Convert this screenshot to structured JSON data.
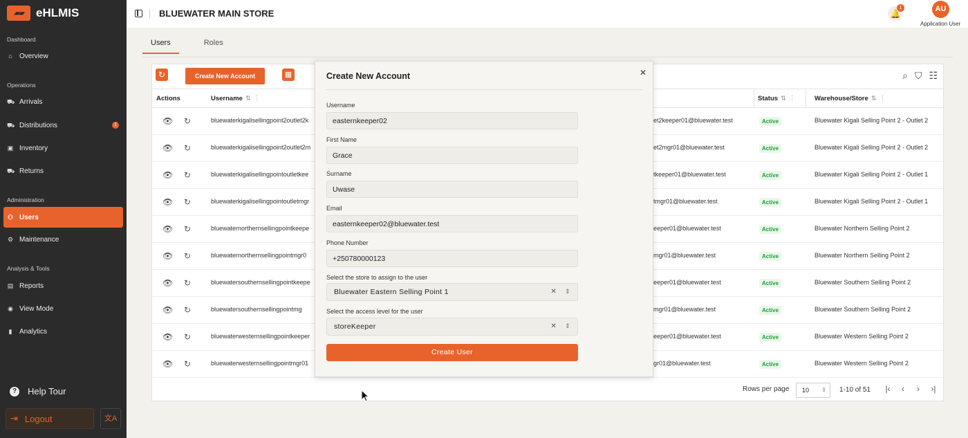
{
  "app": {
    "name": "eHLMIS"
  },
  "sidebar": {
    "sections": [
      {
        "label": "Dashboard"
      },
      {
        "label": "Operations"
      },
      {
        "label": "Administration"
      },
      {
        "label": "Analysis & Tools"
      }
    ],
    "items": [
      {
        "label": "Overview",
        "icon": "home-icon"
      },
      {
        "label": "Arrivals",
        "icon": "truck-icon"
      },
      {
        "label": "Distributions",
        "icon": "truck-icon",
        "badge": "1"
      },
      {
        "label": "Inventory",
        "icon": "box-icon"
      },
      {
        "label": "Returns",
        "icon": "truck-icon"
      },
      {
        "label": "Users",
        "icon": "users-icon",
        "active": true
      },
      {
        "label": "Maintenance",
        "icon": "gear-icon"
      },
      {
        "label": "Reports",
        "icon": "file-icon"
      },
      {
        "label": "View Mode",
        "icon": "eye-icon"
      },
      {
        "label": "Analytics",
        "icon": "bar-chart-icon"
      }
    ],
    "help": "Help Tour",
    "logout": "Logout",
    "lang_icon": "文A"
  },
  "header": {
    "store": "BLUEWATER MAIN STORE",
    "notification_count": "1",
    "avatar_initials": "AU",
    "user_role": "Application User"
  },
  "tabs": [
    {
      "label": "Users"
    },
    {
      "label": "Roles"
    }
  ],
  "toolbar": {
    "create_label": "Create New Account"
  },
  "table": {
    "headers": {
      "actions": "Actions",
      "username": "Username",
      "status": "Status",
      "warehouse": "Warehouse/Store"
    },
    "rows": [
      {
        "username": "bluewaterkigalisellingpoint2outlet2k",
        "email": "et2keeper01@bluewater.test",
        "status": "Active",
        "warehouse": "Bluewater Kigali Selling Point 2 - Outlet 2"
      },
      {
        "username": "bluewaterkigalisellingpoint2outlet2m",
        "email": "et2mgr01@bluewater.test",
        "status": "Active",
        "warehouse": "Bluewater Kigali Selling Point 2 - Outlet 2"
      },
      {
        "username": "bluewaterkigalisellingpointoutletkee",
        "email": "tkeeper01@bluewater.test",
        "status": "Active",
        "warehouse": "Bluewater Kigali Selling Point 2 - Outlet 1"
      },
      {
        "username": "bluewaterkigalisellingpointoutletmgr",
        "email": "tmgr01@bluewater.test",
        "status": "Active",
        "warehouse": "Bluewater Kigali Selling Point 2 - Outlet 1"
      },
      {
        "username": "bluewaternorthernsellingpointkeepe",
        "email": "eeper01@bluewater.test",
        "status": "Active",
        "warehouse": "Bluewater Northern Selling Point 2"
      },
      {
        "username": "bluewaternorthernsellingpointmgr0",
        "email": "mgr01@bluewater.test",
        "status": "Active",
        "warehouse": "Bluewater Northern Selling Point 2"
      },
      {
        "username": "bluewatersouthernsellingpointkeepe",
        "email": "eeper01@bluewater.test",
        "status": "Active",
        "warehouse": "Bluewater Southern Selling Point 2"
      },
      {
        "username": "bluewatersouthernsellingpointmg",
        "email": "mgr01@bluewater.test",
        "status": "Active",
        "warehouse": "Bluewater Southern Selling Point 2"
      },
      {
        "username": "bluewaterwesternsellingpointkeeper",
        "email": "eeper01@bluewater.test",
        "status": "Active",
        "warehouse": "Bluewater Western Selling Point 2"
      },
      {
        "username": "bluewaterwesternsellingpointmgr01",
        "email": "gr01@bluewater.test",
        "status": "Active",
        "warehouse": "Bluewater Western Selling Point 2"
      }
    ]
  },
  "pagination": {
    "rows_per_page_label": "Rows per page",
    "rows_per_page": "10",
    "range": "1-10 of 51"
  },
  "modal": {
    "title": "Create New Account",
    "fields": {
      "username": {
        "label": "Username",
        "value": "easternkeeper02"
      },
      "first_name": {
        "label": "First Name",
        "value": "Grace"
      },
      "surname": {
        "label": "Surname",
        "value": "Uwase"
      },
      "email": {
        "label": "Email",
        "value": "easternkeeper02@bluewater.test"
      },
      "phone": {
        "label": "Phone Number",
        "value": "+250780000123"
      },
      "store": {
        "label": "Select the store to assign to the user",
        "value": "Bluewater Eastern Selling Point 1"
      },
      "access": {
        "label": "Select the access level for the user",
        "value": "storeKeeper"
      }
    },
    "submit": "Create User"
  },
  "colors": {
    "accent": "#e8632b",
    "sidebar": "#2b2b2b",
    "active_status": "#1f9d3a"
  }
}
